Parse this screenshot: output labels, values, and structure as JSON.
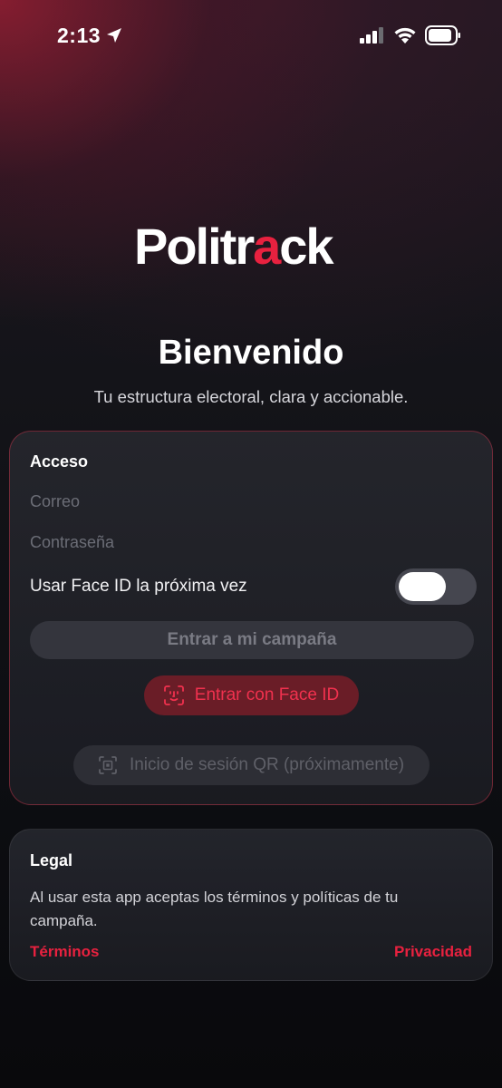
{
  "status_bar": {
    "time": "2:13"
  },
  "brand": {
    "logo_prefix": "Politr",
    "logo_accent": "a",
    "logo_suffix": "ck",
    "accent_color": "#e8213f"
  },
  "header": {
    "title": "Bienvenido",
    "subtitle": "Tu estructura electoral, clara y accionable."
  },
  "access_card": {
    "title": "Acceso",
    "email_placeholder": "Correo",
    "password_placeholder": "Contraseña",
    "face_id_toggle_label": "Usar Face ID la próxima vez",
    "face_id_toggle_on": false,
    "enter_button": "Entrar a mi campaña",
    "face_id_button": "Entrar con Face ID",
    "qr_button": "Inicio de sesión QR (próximamente)"
  },
  "legal_card": {
    "title": "Legal",
    "text": "Al usar esta app aceptas los términos y políticas de tu campaña.",
    "terms_link": "Términos",
    "privacy_link": "Privacidad"
  }
}
